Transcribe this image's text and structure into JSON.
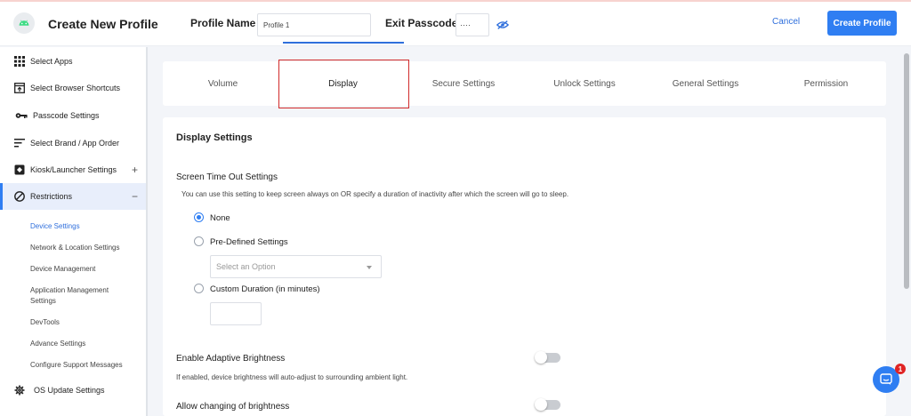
{
  "header": {
    "title": "Create New Profile",
    "profile_name_label": "Profile Name",
    "profile_name_value": "Profile 1",
    "exit_passcode_label": "Exit Passcode",
    "exit_passcode_value": "····",
    "cancel_label": "Cancel",
    "create_label": "Create Profile"
  },
  "sidebar": {
    "items": [
      {
        "label": "Select Apps",
        "icon": "apps-grid-icon"
      },
      {
        "label": "Select Browser Shortcuts",
        "icon": "browser-shortcut-icon"
      },
      {
        "label": "Passcode Settings",
        "icon": "key-icon"
      },
      {
        "label": "Select Brand / App Order",
        "icon": "sort-icon"
      },
      {
        "label": "Kiosk/Launcher Settings",
        "icon": "kiosk-icon",
        "expander": "+"
      },
      {
        "label": "Restrictions",
        "icon": "ban-icon",
        "expander": "−"
      }
    ],
    "sub_items": [
      "Device Settings",
      "Network & Location Settings",
      "Device Management",
      "Application Management Settings",
      "DevTools",
      "Advance Settings",
      "Configure Support Messages"
    ],
    "bottom_item": {
      "label": "OS Update Settings",
      "icon": "gear-icon"
    }
  },
  "tabs": [
    "Volume",
    "Display",
    "Secure Settings",
    "Unlock Settings",
    "General Settings",
    "Permission"
  ],
  "main": {
    "section_title": "Display Settings",
    "screen_timeout_title": "Screen Time Out Settings",
    "screen_timeout_desc": "You can use this setting to keep screen always on OR specify a duration of inactivity after which the screen will go to sleep.",
    "option_none": "None",
    "option_predefined": "Pre-Defined Settings",
    "select_placeholder": "Select an Option",
    "option_custom": "Custom Duration (in minutes)",
    "adaptive_label": "Enable Adaptive Brightness",
    "adaptive_desc": "If enabled, device brightness will auto-adjust to surrounding ambient light.",
    "allow_brightness_label": "Allow changing of brightness"
  },
  "chat": {
    "badge": "1"
  },
  "colors": {
    "accent": "#2f7ef2",
    "highlight": "#d12b2b"
  }
}
